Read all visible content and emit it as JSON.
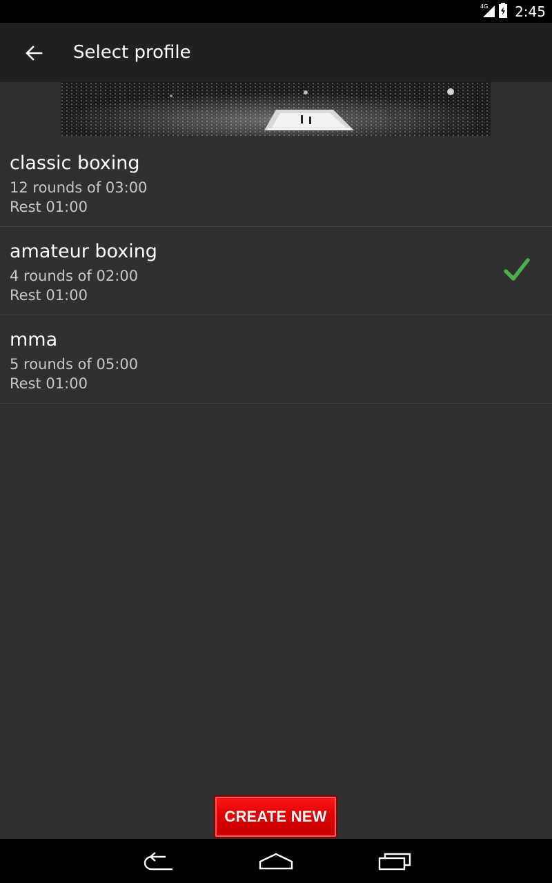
{
  "status_bar": {
    "network": "4G",
    "time": "2:45"
  },
  "action_bar": {
    "title": "Select profile"
  },
  "profiles": [
    {
      "name": "classic boxing",
      "rounds": "12 rounds of 03:00",
      "rest": "Rest 01:00",
      "selected": false
    },
    {
      "name": "amateur boxing",
      "rounds": "4 rounds of 02:00",
      "rest": "Rest 01:00",
      "selected": true
    },
    {
      "name": "mma",
      "rounds": "5 rounds of 05:00",
      "rest": "Rest 01:00",
      "selected": false
    }
  ],
  "create_button": {
    "label": "CREATE NEW"
  },
  "colors": {
    "background": "#303030",
    "action_bar": "#212121",
    "check": "#4caf50",
    "button_red": "#e00000"
  }
}
